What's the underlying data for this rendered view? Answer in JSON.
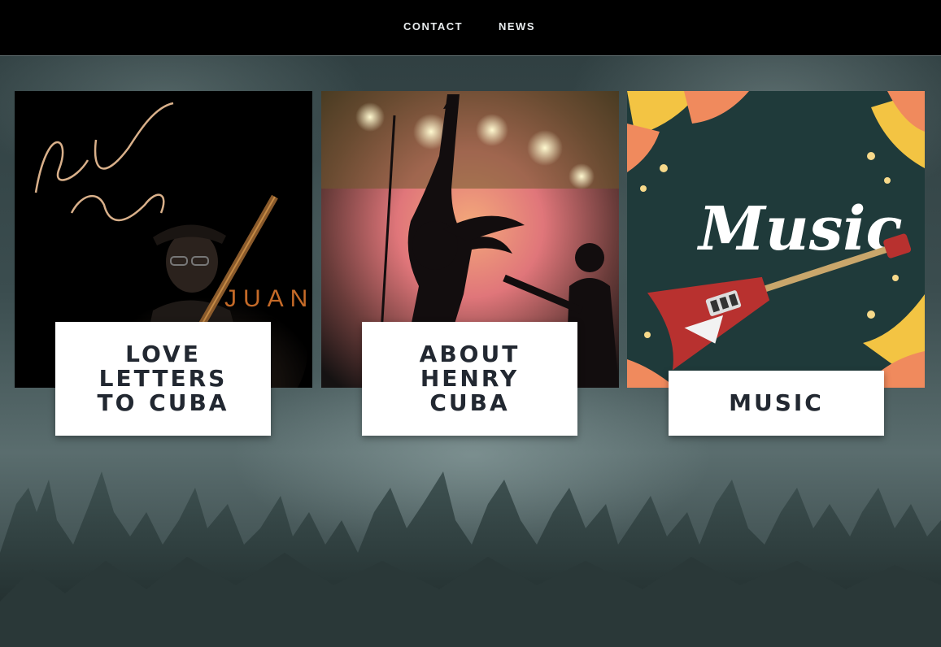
{
  "nav": {
    "items": [
      {
        "label": "CONTACT"
      },
      {
        "label": "NEWS"
      }
    ]
  },
  "cards": [
    {
      "title": "LOVE LETTERS TO CUBA",
      "image_script_text": [
        "Love Letters",
        "to Cuba"
      ],
      "image_name_text": "JUAN"
    },
    {
      "title": "ABOUT HENRY CUBA"
    },
    {
      "title": "MUSIC",
      "image_script_text": "Music"
    }
  ],
  "colors": {
    "nav_bg": "#000000",
    "label_bg": "#ffffff",
    "title_text": "#222831",
    "music_panel": "#1f3a3a",
    "guitar_red": "#b8312f"
  }
}
